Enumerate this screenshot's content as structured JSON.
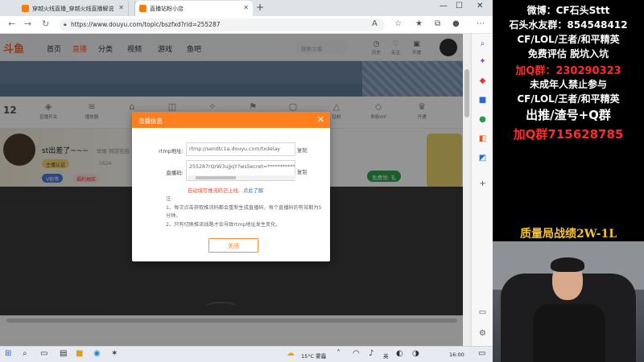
{
  "browser": {
    "tabs": [
      {
        "label": "穿越火线直播_穿越火线直播解说"
      },
      {
        "label": "穿越火线直播_穿越火线直播解说"
      },
      {
        "label": "直播站粉小店"
      }
    ],
    "url": "https://www.douyu.com/topic/bszfxd?rid=255287"
  },
  "site": {
    "nav": [
      "首页",
      "直播",
      "分类",
      "视频",
      "游戏",
      "鱼吧"
    ],
    "search_placeholder": "搜索主播",
    "header_icons": [
      "历史",
      "关注",
      "开播"
    ],
    "level": "12",
    "func_labels": [
      "直播开关",
      "播放器",
      "清晰度",
      "弹幕",
      "全屏",
      "画质",
      "设置",
      "更多",
      "直播时长",
      "钻粉",
      "贵族VIP",
      "开通"
    ]
  },
  "streamer": {
    "name": "st出差了~~~",
    "sub": "举报  网游竞技",
    "tags": [
      "主播认证",
      "V粉等",
      "福利抽奖"
    ],
    "count": "1624",
    "badge_text": "免费领: 礼",
    "vip_btn": "免费领: 礼"
  },
  "modal": {
    "title": "直播信息",
    "close_icon": "close-icon",
    "rtmp_label": "rtmp地址:",
    "rtmp_value": "rtmp://sendtc1a.douyu.com/txdelay",
    "key_label": "直播码:",
    "key_value": "255287rQrW3ujJqY?wsSecret=***********",
    "copy_label": "复制",
    "warn_text": "自动填写推流码已上线,",
    "warn_link": "点此了解",
    "notes_title": "注:",
    "notes": [
      "1、每次点击获取推流码都会重新生成直播码，每个直播码的有效期为5分钟。",
      "2、只有切换推流线路才会导致rtmp地址发生变化。"
    ],
    "close_button": "关闭"
  },
  "taskbar": {
    "weather": "15°C 雾霾",
    "lang": "英",
    "time": "16:00"
  },
  "overlay": {
    "lines": [
      "微博：CF石头Sttt",
      "石头水友群：854548412",
      "CF/LOL/王者/和平精英",
      "免费评估 脱坑入坑",
      "加Q群：230290323",
      "未成年人禁止参与",
      "CF/LOL/王者/和平精英",
      "出推/渣号+Q群",
      "加Q群715628785"
    ],
    "record": "质量局战绩2W-1L"
  }
}
